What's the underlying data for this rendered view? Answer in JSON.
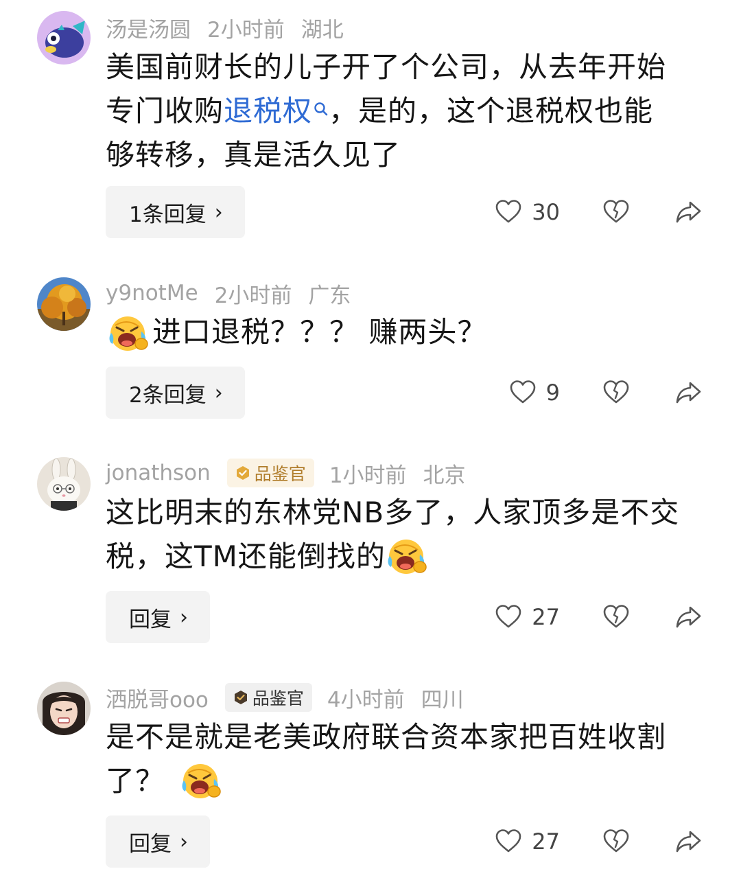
{
  "comments": [
    {
      "username": "汤是汤圆",
      "badge": null,
      "time": "2小时前",
      "location": "湖北",
      "line1": "美国前财长的儿子开了个公司，从去年开始",
      "line2_pre": "专门收购",
      "line2_link": "退税权",
      "line2_post": "，是的，这个退税权也能",
      "line3": "够转移，真是活久见了",
      "reply_label": "1条回复",
      "likes": "30",
      "avatar_icon": "fish-avatar-icon"
    },
    {
      "username": "y9notMe",
      "badge": null,
      "time": "2小时前",
      "location": "广东",
      "line1": "进口退税？？？ 赚两头？",
      "reply_label": "2条回复",
      "likes": "9",
      "avatar_icon": "autumn-tree-avatar-icon"
    },
    {
      "username": "jonathson",
      "badge": "品鉴官",
      "time": "1小时前",
      "location": "北京",
      "line1": "这比明末的东林党NB多了，人家顶多是不交",
      "line2": "税，这TM还能倒找的",
      "reply_label": "回复",
      "likes": "27",
      "avatar_icon": "bunny-avatar-icon"
    },
    {
      "username": "洒脱哥ooo",
      "badge": "品鉴官",
      "time": "4小时前",
      "location": "四川",
      "line1": "是不是就是老美政府联合资本家把百姓收割",
      "line2": "了？",
      "reply_label": "回复",
      "likes": "27",
      "avatar_icon": "girl-avatar-icon"
    }
  ],
  "icons": {
    "like": "heart-outline-icon",
    "dislike": "broken-heart-icon",
    "share": "share-arrow-icon",
    "emoji": "laughing-crying-emoji-icon",
    "search": "search-icon",
    "reply_chevron": "›"
  },
  "colors": {
    "link": "#2f6bd4",
    "meta": "#a3a3a3",
    "gold_badge": "#b07d2b"
  }
}
